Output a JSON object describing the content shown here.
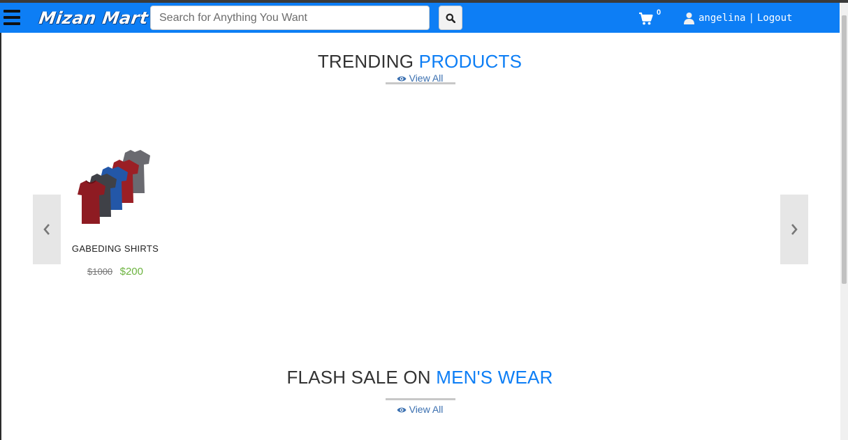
{
  "header": {
    "logo_text": "Mizan Mart",
    "search": {
      "placeholder": "Search for Anything You Want",
      "value": ""
    },
    "cart_count": "0",
    "user_name": "angelina",
    "separator": "|",
    "logout_label": "Logout"
  },
  "sections": [
    {
      "title_part1": "TRENDING",
      "title_part2": "PRODUCTS",
      "view_all_label": "View All"
    },
    {
      "title_part1": "FLASH SALE ON",
      "title_part2": "MEN'S WEAR",
      "view_all_label": "View All"
    }
  ],
  "products": [
    {
      "name": "GABEDING SHIRTS",
      "old_price": "$1000",
      "new_price": "$200"
    }
  ],
  "colors": {
    "primary": "#0d7ef5",
    "price_green": "#6cb33f"
  }
}
